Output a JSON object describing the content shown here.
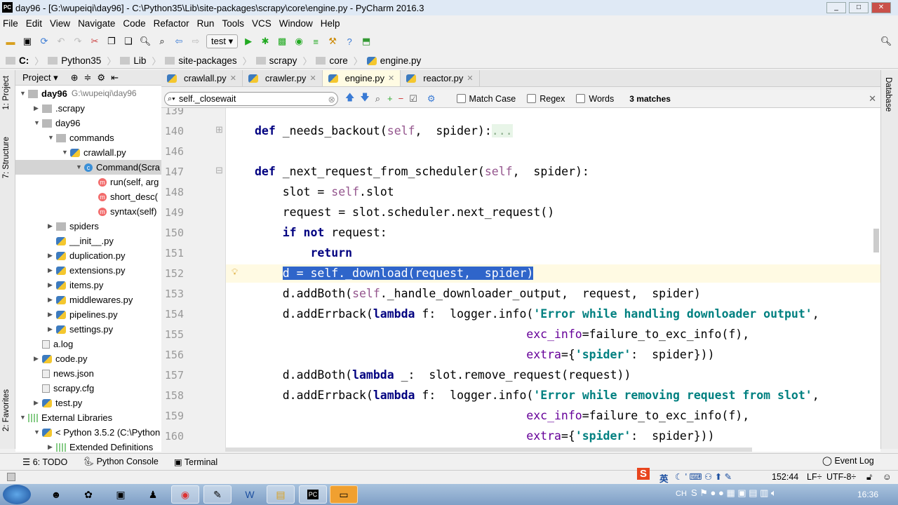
{
  "window": {
    "title": "day96 - [G:\\wupeiqi\\day96] - C:\\Python35\\Lib\\site-packages\\scrapy\\core\\engine.py - PyCharm 2016.3",
    "logo": "PC"
  },
  "menu": [
    "File",
    "Edit",
    "View",
    "Navigate",
    "Code",
    "Refactor",
    "Run",
    "Tools",
    "VCS",
    "Window",
    "Help"
  ],
  "toolbar": {
    "run_config": "test"
  },
  "breadcrumb": [
    "C:",
    "Python35",
    "Lib",
    "site-packages",
    "scrapy",
    "core",
    "engine.py"
  ],
  "side_tabs": {
    "project": "1: Project",
    "structure": "7: Structure",
    "favorites": "2: Favorites",
    "database": "Database"
  },
  "project_panel": {
    "title": "Project"
  },
  "tree": [
    {
      "label": "day96",
      "extra": "G:\\wupeiqi\\day96",
      "level": 0,
      "icon": "folder",
      "open": true
    },
    {
      "label": ".scrapy",
      "level": 1,
      "icon": "folder",
      "open": false
    },
    {
      "label": "day96",
      "level": 1,
      "icon": "folder",
      "open": true
    },
    {
      "label": "commands",
      "level": 2,
      "icon": "folder",
      "open": true
    },
    {
      "label": "crawlall.py",
      "level": 3,
      "icon": "py",
      "open": true
    },
    {
      "label": "Command(Scra",
      "level": 4,
      "icon": "class",
      "open": true,
      "selected": true
    },
    {
      "label": "run(self, arg",
      "level": 5,
      "icon": "method"
    },
    {
      "label": "short_desc(",
      "level": 5,
      "icon": "method"
    },
    {
      "label": "syntax(self)",
      "level": 5,
      "icon": "method"
    },
    {
      "label": "spiders",
      "level": 2,
      "icon": "folder",
      "open": false
    },
    {
      "label": "__init__.py",
      "level": 2,
      "icon": "py"
    },
    {
      "label": "duplication.py",
      "level": 2,
      "icon": "py",
      "open": false
    },
    {
      "label": "extensions.py",
      "level": 2,
      "icon": "py",
      "open": false
    },
    {
      "label": "items.py",
      "level": 2,
      "icon": "py",
      "open": false
    },
    {
      "label": "middlewares.py",
      "level": 2,
      "icon": "py",
      "open": false
    },
    {
      "label": "pipelines.py",
      "level": 2,
      "icon": "py",
      "open": false
    },
    {
      "label": "settings.py",
      "level": 2,
      "icon": "py",
      "open": false
    },
    {
      "label": "a.log",
      "level": 1,
      "icon": "file"
    },
    {
      "label": "code.py",
      "level": 1,
      "icon": "py",
      "open": false
    },
    {
      "label": "news.json",
      "level": 1,
      "icon": "file"
    },
    {
      "label": "scrapy.cfg",
      "level": 1,
      "icon": "file"
    },
    {
      "label": "test.py",
      "level": 1,
      "icon": "py",
      "open": false
    },
    {
      "label": "External Libraries",
      "level": 0,
      "icon": "lib",
      "open": true
    },
    {
      "label": "< Python 3.5.2 (C:\\Python",
      "level": 1,
      "icon": "py",
      "open": true
    },
    {
      "label": "Extended Definitions",
      "level": 2,
      "icon": "lib",
      "open": false
    }
  ],
  "tabs": [
    {
      "label": "crawlall.py"
    },
    {
      "label": "crawler.py"
    },
    {
      "label": "engine.py",
      "active": true
    },
    {
      "label": "reactor.py"
    }
  ],
  "find": {
    "query": "self._closewait",
    "match_case": "Match Case",
    "regex": "Regex",
    "words": "Words",
    "matches": "3 matches"
  },
  "code": [
    {
      "n": "139",
      "segs": []
    },
    {
      "n": "140",
      "indent": 0,
      "segs": [
        [
          "kw",
          "def "
        ],
        [
          "",
          "_needs_backout("
        ],
        [
          "sf",
          "self"
        ],
        [
          "",
          ",  spider):"
        ],
        [
          "fold",
          "..."
        ]
      ]
    },
    {
      "n": "146",
      "segs": []
    },
    {
      "n": "147",
      "indent": 0,
      "segs": [
        [
          "kw",
          "def "
        ],
        [
          "",
          "_next_request_from_scheduler("
        ],
        [
          "sf",
          "self"
        ],
        [
          "",
          ",  spider):"
        ]
      ]
    },
    {
      "n": "148",
      "indent": 4,
      "segs": [
        [
          "",
          "slot = "
        ],
        [
          "sf",
          "self"
        ],
        [
          "",
          ".slot"
        ]
      ]
    },
    {
      "n": "149",
      "indent": 4,
      "segs": [
        [
          "",
          "request = slot.scheduler.next_request()"
        ]
      ]
    },
    {
      "n": "150",
      "indent": 4,
      "segs": [
        [
          "kw",
          "if not "
        ],
        [
          "",
          "request:"
        ]
      ]
    },
    {
      "n": "151",
      "indent": 8,
      "segs": [
        [
          "kw",
          "return"
        ]
      ]
    },
    {
      "n": "152",
      "indent": 4,
      "current": true,
      "segs": [
        [
          "sel",
          "d = self._download(request,  spider)"
        ]
      ]
    },
    {
      "n": "153",
      "indent": 4,
      "segs": [
        [
          "",
          "d.addBoth("
        ],
        [
          "sf",
          "self"
        ],
        [
          "",
          "._handle_downloader_output,  request,  spider)"
        ]
      ]
    },
    {
      "n": "154",
      "indent": 4,
      "segs": [
        [
          "",
          "d.addErrback("
        ],
        [
          "kw",
          "lambda "
        ],
        [
          "",
          "f:  logger.info("
        ],
        [
          "st",
          "'Error while handling downloader output'"
        ],
        [
          "",
          ","
        ]
      ]
    },
    {
      "n": "155",
      "indent": 39,
      "segs": [
        [
          "pa",
          "exc_info"
        ],
        [
          "",
          "=failure_to_exc_info(f),"
        ]
      ]
    },
    {
      "n": "156",
      "indent": 39,
      "segs": [
        [
          "pa",
          "extra"
        ],
        [
          "",
          "={"
        ],
        [
          "st",
          "'spider'"
        ],
        [
          "",
          ":  spider}))"
        ]
      ]
    },
    {
      "n": "157",
      "indent": 4,
      "segs": [
        [
          "",
          "d.addBoth("
        ],
        [
          "kw",
          "lambda "
        ],
        [
          "",
          "_:  slot.remove_request(request))"
        ]
      ]
    },
    {
      "n": "158",
      "indent": 4,
      "segs": [
        [
          "",
          "d.addErrback("
        ],
        [
          "kw",
          "lambda "
        ],
        [
          "",
          "f:  logger.info("
        ],
        [
          "st",
          "'Error while removing request from slot'"
        ],
        [
          "",
          ","
        ]
      ]
    },
    {
      "n": "159",
      "indent": 39,
      "segs": [
        [
          "pa",
          "exc_info"
        ],
        [
          "",
          "=failure_to_exc_info(f),"
        ]
      ]
    },
    {
      "n": "160",
      "indent": 39,
      "segs": [
        [
          "pa",
          "extra"
        ],
        [
          "",
          "={"
        ],
        [
          "st",
          "'spider'"
        ],
        [
          "",
          ":  spider}))"
        ]
      ]
    }
  ],
  "bottom_tabs": [
    "6: TODO",
    "Python Console",
    "Terminal"
  ],
  "event_log": "Event Log",
  "status": {
    "position": "152:44",
    "line_sep": "LF÷",
    "encoding": "UTF-8÷",
    "ime": "英"
  },
  "taskbar": {
    "lang": "CH",
    "clock": "16:36"
  },
  "colors": {
    "selection": "#2f65ca",
    "current_line": "#fffae3",
    "keyword": "#000080",
    "string": "#008080"
  }
}
